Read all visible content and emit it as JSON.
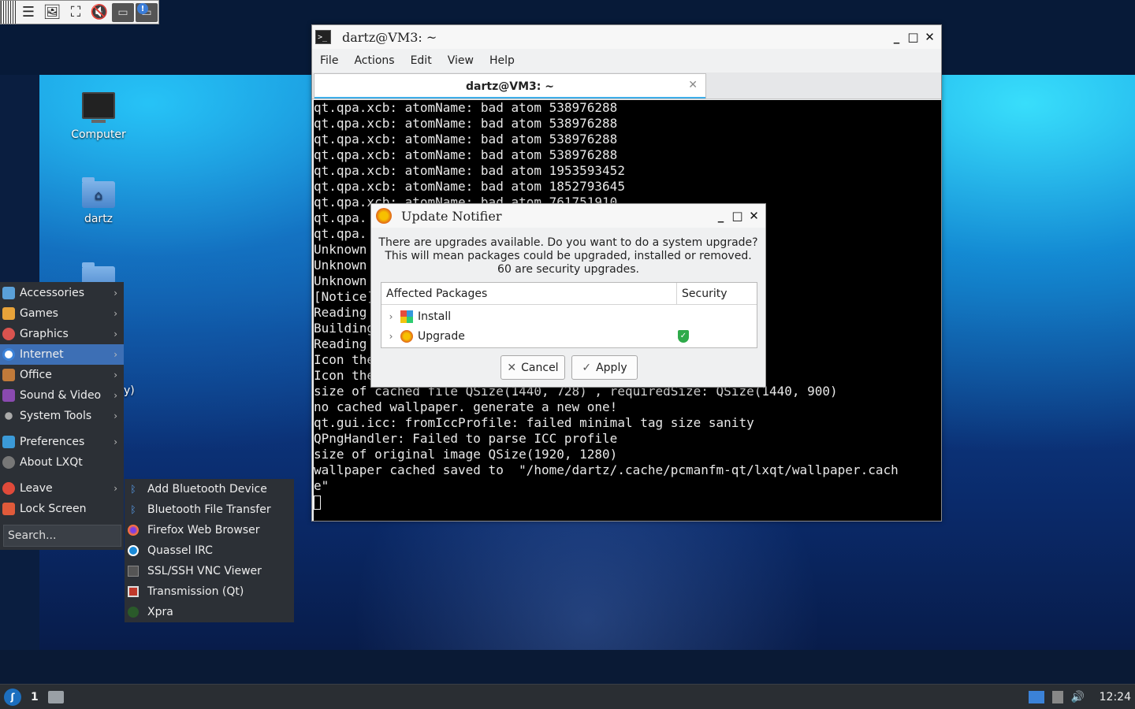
{
  "toolbar": {
    "icons": [
      "menu-icon",
      "image-icon",
      "fullscreen-icon",
      "mute-icon",
      "display-icon",
      "notification-icon"
    ],
    "notif_badge": "!"
  },
  "desktop": {
    "icons": [
      {
        "label": "Computer",
        "icon": "computer-icon"
      },
      {
        "label": "dartz",
        "icon": "home-folder-icon"
      }
    ],
    "clipped_label": "y)"
  },
  "terminal": {
    "title": "dartz@VM3: ~",
    "menu": [
      "File",
      "Actions",
      "Edit",
      "View",
      "Help"
    ],
    "tab_label": "dartz@VM3: ~",
    "lines": [
      "qt.qpa.xcb: atomName: bad atom 538976288",
      "qt.qpa.xcb: atomName: bad atom 538976288",
      "qt.qpa.xcb: atomName: bad atom 538976288",
      "qt.qpa.xcb: atomName: bad atom 538976288",
      "qt.qpa.xcb: atomName: bad atom 1953593452",
      "qt.qpa.xcb: atomName: bad atom 1852793645",
      "qt.qpa.xcb: atomName: bad atom 761751910",
      "qt.qpa.",
      "qt.qpa.",
      "Unknown",
      "Unknown",
      "Unknown",
      "[Notice]",
      "Reading",
      "Building",
      "Reading",
      "Icon the",
      "Icon the",
      "size of cached file QSize(1440, 728) , requiredSize: QSize(1440, 900)",
      "no cached wallpaper. generate a new one!",
      "qt.gui.icc: fromIccProfile: failed minimal tag size sanity",
      "QPngHandler: Failed to parse ICC profile",
      "size of original image QSize(1920, 1280)",
      "wallpaper cached saved to  \"/home/dartz/.cache/pcmanfm-qt/lxqt/wallpaper.cach",
      "e\""
    ]
  },
  "dialog": {
    "title": "Update Notifier",
    "message_1": "There are upgrades available. Do you want to do a system upgrade?",
    "message_2": "This will mean packages could be upgraded, installed or removed.",
    "message_3": "60 are security upgrades.",
    "col_packages": "Affected Packages",
    "col_security": "Security",
    "rows": [
      {
        "label": "Install",
        "security": false
      },
      {
        "label": "Upgrade",
        "security": true
      }
    ],
    "cancel_label": "Cancel",
    "apply_label": "Apply"
  },
  "app_menu": {
    "items": [
      {
        "label": "Accessories",
        "icon": "accessories-icon",
        "color": "#5aa0d8"
      },
      {
        "label": "Games",
        "icon": "games-icon",
        "color": "#e8a33a"
      },
      {
        "label": "Graphics",
        "icon": "graphics-icon",
        "color": "#d9534f"
      },
      {
        "label": "Internet",
        "icon": "internet-icon",
        "color": "#3b82d8"
      },
      {
        "label": "Office",
        "icon": "office-icon",
        "color": "#c07a3a"
      },
      {
        "label": "Sound & Video",
        "icon": "sound-video-icon",
        "color": "#8a4ab0"
      },
      {
        "label": "System Tools",
        "icon": "system-tools-icon",
        "color": "#aaaaaa"
      },
      {
        "label": "Preferences",
        "icon": "preferences-icon",
        "color": "#3b9ad8"
      },
      {
        "label": "About LXQt",
        "icon": "about-icon",
        "color": "#777777"
      },
      {
        "label": "Leave",
        "icon": "leave-icon",
        "color": "#e04a3a"
      },
      {
        "label": "Lock Screen",
        "icon": "lock-icon",
        "color": "#e05a3a"
      }
    ],
    "search_placeholder": "Search..."
  },
  "internet_submenu": {
    "items": [
      {
        "label": "Add Bluetooth Device",
        "icon": "bluetooth-icon"
      },
      {
        "label": "Bluetooth File Transfer",
        "icon": "bluetooth-icon"
      },
      {
        "label": "Firefox Web Browser",
        "icon": "firefox-icon"
      },
      {
        "label": "Quassel IRC",
        "icon": "quassel-icon"
      },
      {
        "label": "SSL/SSH VNC Viewer",
        "icon": "vnc-icon"
      },
      {
        "label": "Transmission (Qt)",
        "icon": "transmission-icon"
      },
      {
        "label": "Xpra",
        "icon": "xpra-icon"
      }
    ]
  },
  "taskbar": {
    "workspace": "1",
    "clock": "12:24"
  }
}
